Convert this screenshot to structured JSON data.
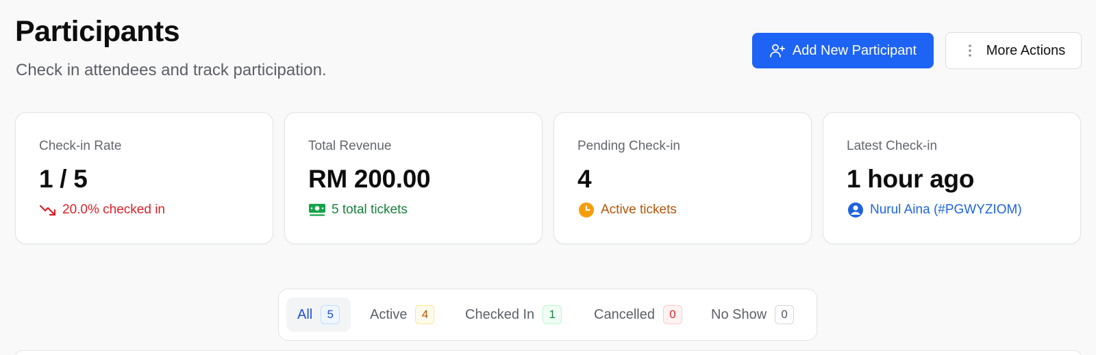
{
  "header": {
    "title": "Participants",
    "subtitle": "Check in attendees and track participation."
  },
  "actions": {
    "add_label": "Add New Participant",
    "add_icon": "user-plus-icon",
    "more_label": "More Actions",
    "more_icon": "vertical-dots-icon"
  },
  "stats": [
    {
      "label": "Check-in Rate",
      "value": "1 / 5",
      "sub": "20.0% checked in",
      "icon": "trending-down-icon",
      "color": "#d91f26"
    },
    {
      "label": "Total Revenue",
      "value": "RM 200.00",
      "sub": "5 total tickets",
      "icon": "money-icon",
      "color": "#15803d"
    },
    {
      "label": "Pending Check-in",
      "value": "4",
      "sub": "Active tickets",
      "icon": "clock-icon",
      "color": "#b45309"
    },
    {
      "label": "Latest Check-in",
      "value": "1 hour ago",
      "sub": "Nurul Aina (#PGWYZIOM)",
      "icon": "user-circle-icon",
      "color": "#1d63e0"
    }
  ],
  "tabs": [
    {
      "label": "All",
      "count": "5",
      "selected": true,
      "badge_bg": "#eff6ff",
      "badge_border": "#bfdbfe",
      "badge_text": "#1d4ed8"
    },
    {
      "label": "Active",
      "count": "4",
      "selected": false,
      "badge_bg": "#fffbeb",
      "badge_border": "#fde68a",
      "badge_text": "#b45309"
    },
    {
      "label": "Checked In",
      "count": "1",
      "selected": false,
      "badge_bg": "#f0fdf4",
      "badge_border": "#bbf7d0",
      "badge_text": "#15803d"
    },
    {
      "label": "Cancelled",
      "count": "0",
      "selected": false,
      "badge_bg": "#fef2f2",
      "badge_border": "#fecaca",
      "badge_text": "#dc2626"
    },
    {
      "label": "No Show",
      "count": "0",
      "selected": false,
      "badge_bg": "#ffffff",
      "badge_border": "#d1d5db",
      "badge_text": "#4b5563"
    }
  ],
  "colors": {
    "primary": "#1d63f4",
    "page_bg": "#f9f9f9"
  }
}
